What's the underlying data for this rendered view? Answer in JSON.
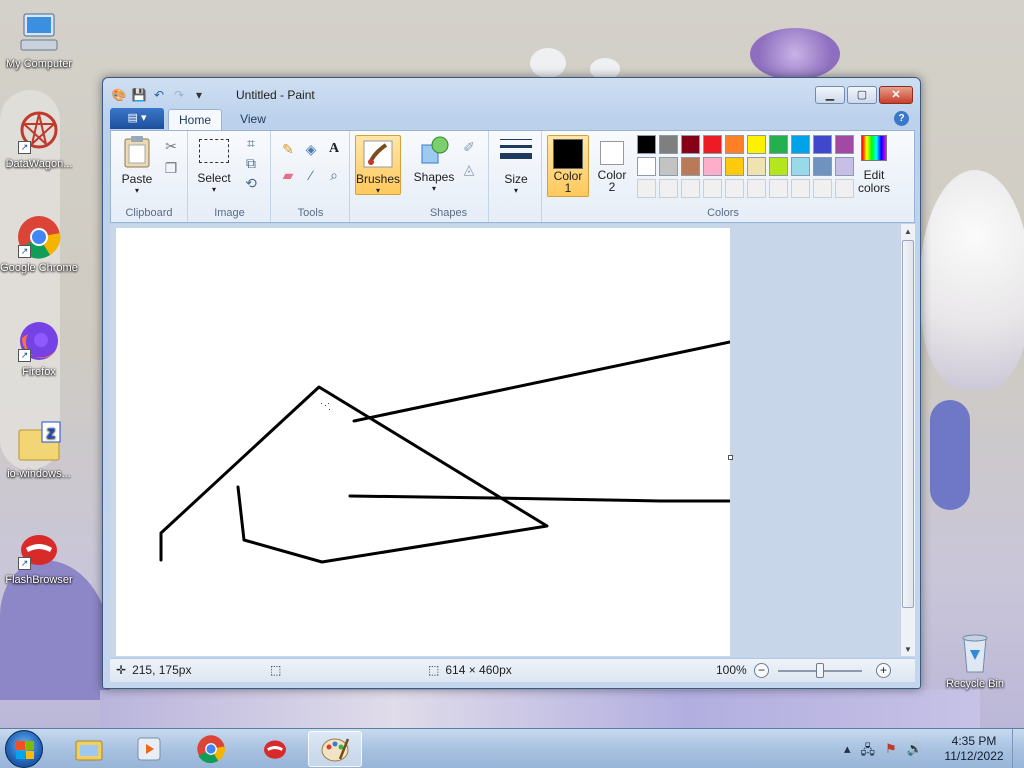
{
  "desktop": {
    "icons": [
      {
        "label": "My Computer"
      },
      {
        "label": "DataWagon..."
      },
      {
        "label": "Google Chrome"
      },
      {
        "label": "Firefox"
      },
      {
        "label": "io-windows..."
      },
      {
        "label": "FlashBrowser"
      },
      {
        "label": "Recycle Bin"
      }
    ]
  },
  "window": {
    "title": "Untitled - Paint",
    "controls": {
      "minimize": "▁",
      "maximize": "▢",
      "close": "✕"
    }
  },
  "tabs": {
    "app_menu": "▤ ▾",
    "home": "Home",
    "view": "View",
    "help": "?"
  },
  "ribbon": {
    "clipboard": {
      "group": "Clipboard",
      "paste": "Paste"
    },
    "image": {
      "group": "Image",
      "select": "Select"
    },
    "tools": {
      "group": "Tools"
    },
    "brushes": {
      "label": "Brushes"
    },
    "shapes": {
      "group": "Shapes",
      "shapes_label": "Shapes"
    },
    "size": {
      "label": "Size"
    },
    "colors": {
      "group": "Colors",
      "color1": "Color",
      "color1_num": "1",
      "color2": "Color",
      "color2_num": "2",
      "edit": "Edit",
      "edit2": "colors",
      "color1_value": "#000000",
      "color2_value": "#ffffff",
      "palette_row1": [
        "#000000",
        "#7f7f7f",
        "#880015",
        "#ed1c24",
        "#ff7f27",
        "#fff200",
        "#22b14c",
        "#00a2e8",
        "#3f48cc",
        "#a349a4"
      ],
      "palette_row2": [
        "#ffffff",
        "#c3c3c3",
        "#b97a57",
        "#ffaec9",
        "#ffc90e",
        "#efe4b0",
        "#b5e61d",
        "#99d9ea",
        "#7092be",
        "#c8bfe7"
      ]
    }
  },
  "status": {
    "cursor_pos": "215, 175px",
    "canvas_size": "614 × 460px",
    "zoom": "100%"
  },
  "taskbar": {
    "time": "4:35 PM",
    "date": "11/12/2022"
  }
}
